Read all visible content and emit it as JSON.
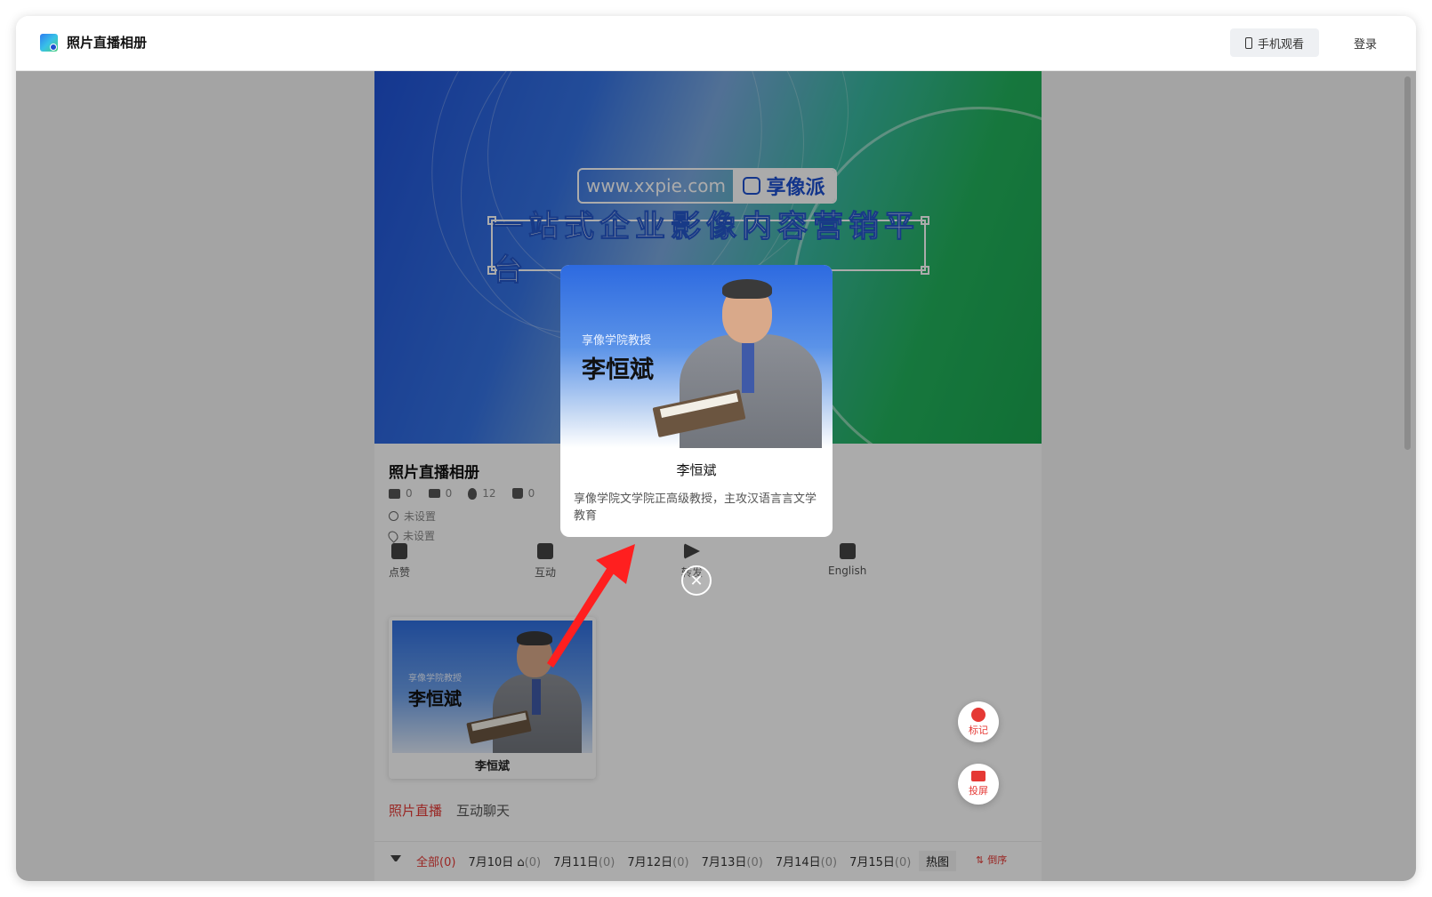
{
  "app": {
    "title": "照片直播相册",
    "mobile_view": "手机观看",
    "login": "登录"
  },
  "banner": {
    "url": "www.xxpie.com",
    "brand": "享像派",
    "slogan": "一站式企业影像内容营销平台"
  },
  "album": {
    "title": "照片直播相册",
    "stats": {
      "photos": "0",
      "videos": "0",
      "views": "12",
      "likes": "0"
    },
    "time": "未设置",
    "location": "未设置"
  },
  "actions": [
    {
      "label": "点赞",
      "icon": "thumb-up-icon"
    },
    {
      "label": "互动",
      "icon": "chat-icon"
    },
    {
      "label": "转发",
      "icon": "share-icon"
    },
    {
      "label": "English",
      "icon": "translate-icon"
    }
  ],
  "speaker": {
    "role": "享像学院教授",
    "name": "李恒斌"
  },
  "modal": {
    "role": "享像学院教授",
    "name_big": "李恒斌",
    "name": "李恒斌",
    "description": "享像学院文学院正高级教授，主攻汉语言言文学教育"
  },
  "tabs": [
    {
      "label": "照片直播",
      "active": true
    },
    {
      "label": "互动聊天",
      "active": false
    }
  ],
  "dates": [
    {
      "label": "全部",
      "count": "(0)",
      "active": true
    },
    {
      "label": "7月10日",
      "count": "(0)",
      "active": false,
      "icon": "cake-icon"
    },
    {
      "label": "7月11日",
      "count": "(0)",
      "active": false
    },
    {
      "label": "7月12日",
      "count": "(0)",
      "active": false
    },
    {
      "label": "7月13日",
      "count": "(0)",
      "active": false
    },
    {
      "label": "7月14日",
      "count": "(0)",
      "active": false
    },
    {
      "label": "7月15日",
      "count": "(0)",
      "active": false
    },
    {
      "label": "7",
      "count": "",
      "active": false
    }
  ],
  "hot": "热图",
  "sort": "倒序",
  "floating": {
    "mark": "标记",
    "cast": "投屏"
  },
  "colors": {
    "accent": "#e53935",
    "brand_blue": "#1d4fd0"
  }
}
